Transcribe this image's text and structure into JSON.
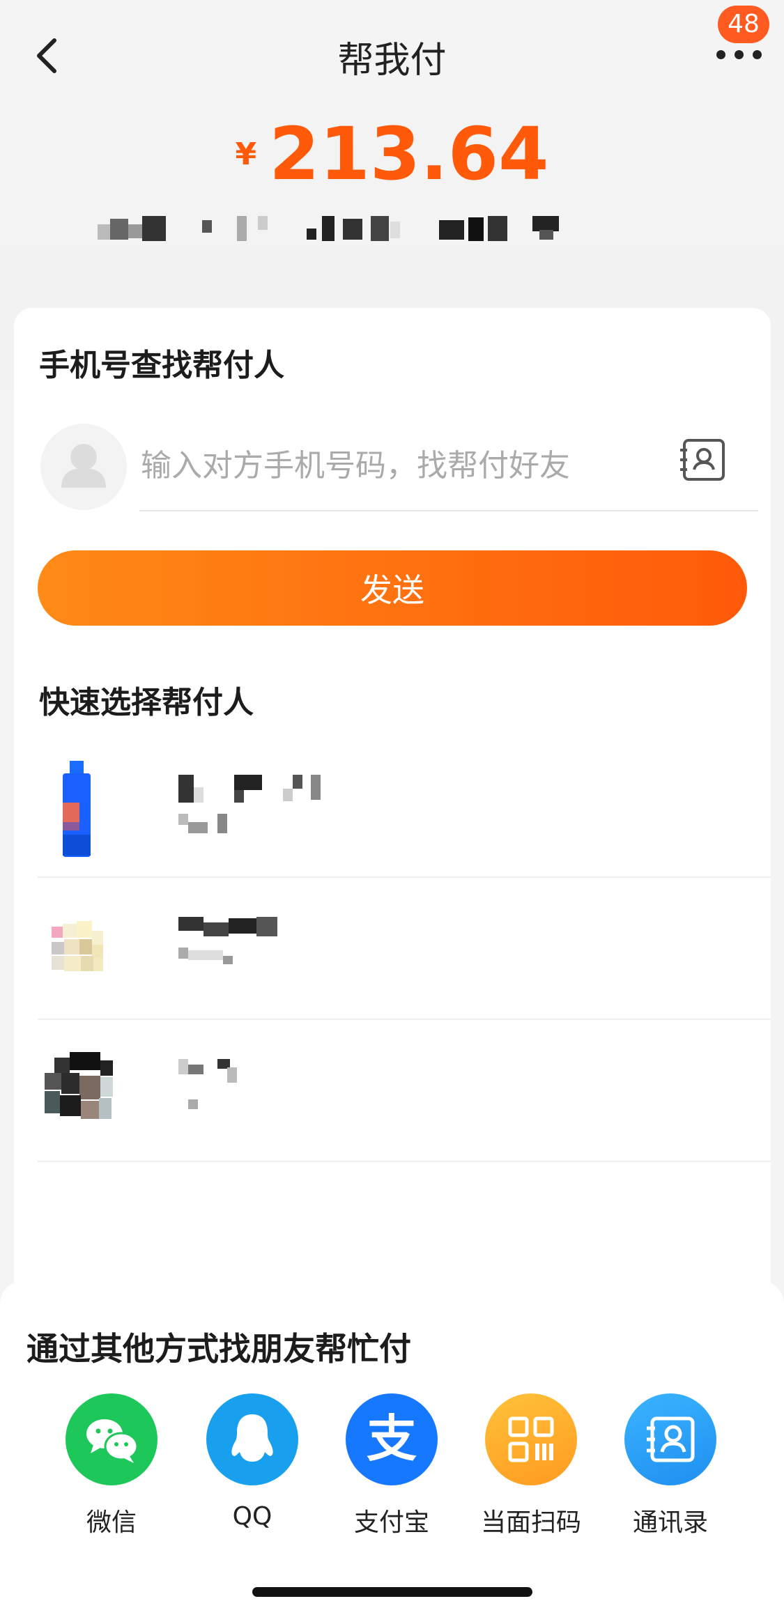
{
  "header": {
    "title": "帮我付",
    "badge_count": "48"
  },
  "payment": {
    "currency": "¥",
    "amount": "213.64"
  },
  "phone_search": {
    "title": "手机号查找帮付人",
    "placeholder": "输入对方手机号码，找帮付好友",
    "send_label": "发送"
  },
  "quick_select": {
    "title": "快速选择帮付人"
  },
  "share": {
    "title": "通过其他方式找朋友帮忙付",
    "items": [
      {
        "label": "微信",
        "icon": "wechat-icon",
        "color": "#1ec75a"
      },
      {
        "label": "QQ",
        "icon": "qq-icon",
        "color": "#18a0ef"
      },
      {
        "label": "支付宝",
        "icon": "alipay-icon",
        "color": "#1677ff"
      },
      {
        "label": "当面扫码",
        "icon": "qr-code-icon",
        "color": "#ffa629"
      },
      {
        "label": "通讯录",
        "icon": "contacts-book-icon",
        "color": "#2aa6f2"
      }
    ]
  },
  "colors": {
    "accent": "#ff5a0a",
    "send_gradient": [
      "#ff8a16",
      "#ff5a0a"
    ]
  }
}
